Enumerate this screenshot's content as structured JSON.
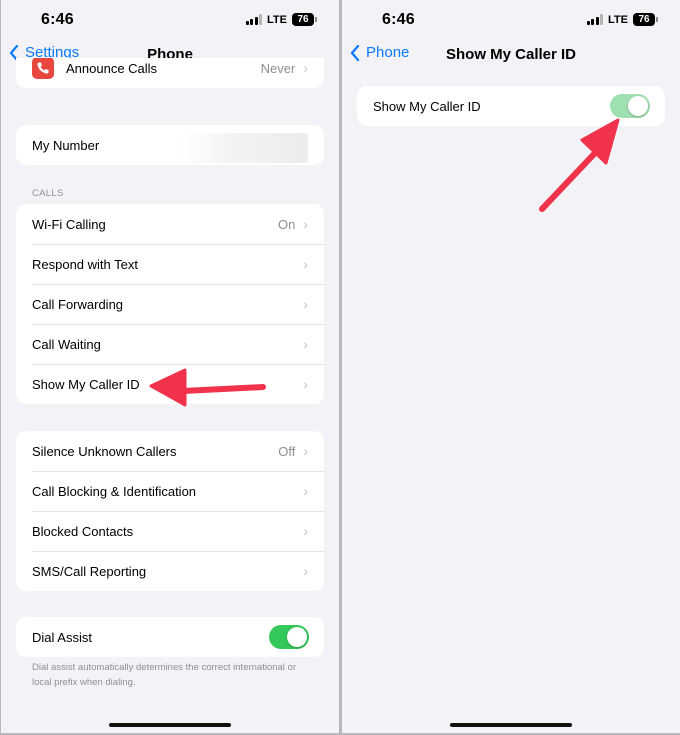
{
  "status": {
    "time": "6:46",
    "network": "LTE",
    "battery": "76"
  },
  "left": {
    "nav": {
      "back_label": "Settings",
      "title": "Phone"
    },
    "announce": {
      "label": "Announce Calls",
      "value": "Never"
    },
    "my_number": {
      "label": "My Number"
    },
    "calls_header": "CALLS",
    "calls_rows": [
      {
        "label": "Wi-Fi Calling",
        "value": "On"
      },
      {
        "label": "Respond with Text",
        "value": ""
      },
      {
        "label": "Call Forwarding",
        "value": ""
      },
      {
        "label": "Call Waiting",
        "value": ""
      },
      {
        "label": "Show My Caller ID",
        "value": ""
      }
    ],
    "block_rows": [
      {
        "label": "Silence Unknown Callers",
        "value": "Off"
      },
      {
        "label": "Call Blocking & Identification",
        "value": ""
      },
      {
        "label": "Blocked Contacts",
        "value": ""
      },
      {
        "label": "SMS/Call Reporting",
        "value": ""
      }
    ],
    "dial_assist": {
      "label": "Dial Assist",
      "on": true
    },
    "dial_assist_footer": "Dial assist automatically determines the correct international or local prefix when dialing."
  },
  "right": {
    "nav": {
      "back_label": "Phone",
      "title": "Show My Caller ID"
    },
    "caller_id": {
      "label": "Show My Caller ID",
      "on": true
    }
  },
  "colors": {
    "accent": "#0a7aff",
    "toggle_on": "#34c759",
    "arrow": "#f0324a",
    "background": "#f2f2f7"
  },
  "icons": [
    "chevron-left-icon",
    "chevron-right-icon",
    "cellular-signal-icon",
    "battery-icon",
    "phone-app-icon",
    "annotation-arrow-icon"
  ]
}
